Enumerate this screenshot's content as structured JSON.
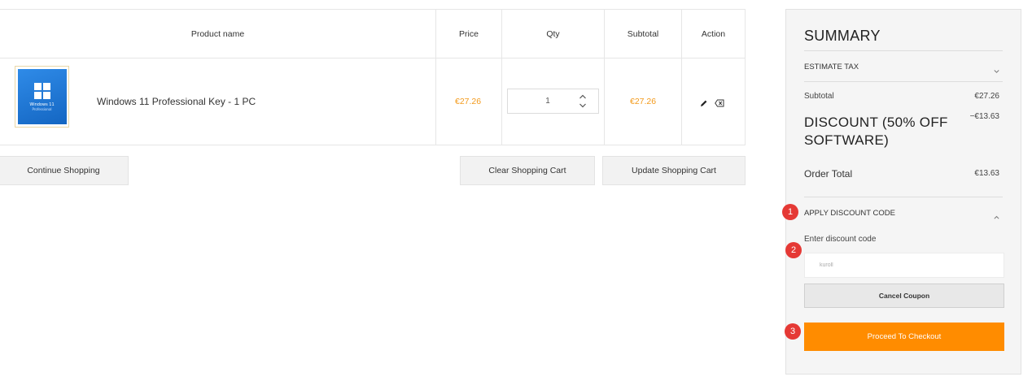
{
  "cart": {
    "headers": {
      "product_name": "Product name",
      "price": "Price",
      "qty": "Qty",
      "subtotal": "Subtotal",
      "action": "Action"
    },
    "item": {
      "name": "Windows 11 Professional Key - 1 PC",
      "image_title": "Windows 11",
      "image_subtitle": "Professional",
      "price": "€27.26",
      "qty": "1",
      "subtotal": "€27.26"
    },
    "buttons": {
      "continue": "Continue Shopping",
      "clear": "Clear Shopping Cart",
      "update": "Update Shopping Cart"
    }
  },
  "summary": {
    "title": "SUMMARY",
    "estimate_tax": "ESTIMATE TAX",
    "subtotal_label": "Subtotal",
    "subtotal_value": "€27.26",
    "discount_label": "DISCOUNT (50% OFF SOFTWARE)",
    "discount_value": "−€13.63",
    "order_total_label": "Order Total",
    "order_total_value": "€13.63",
    "apply_discount": "APPLY DISCOUNT CODE",
    "enter_code_label": "Enter discount code",
    "code_value": "kuroll",
    "cancel_coupon": "Cancel Coupon",
    "checkout": "Proceed To Checkout"
  },
  "markers": [
    "1",
    "2",
    "3"
  ],
  "colors": {
    "accent": "#ff8c00",
    "price": "#f39a1b",
    "marker": "#e53935"
  }
}
